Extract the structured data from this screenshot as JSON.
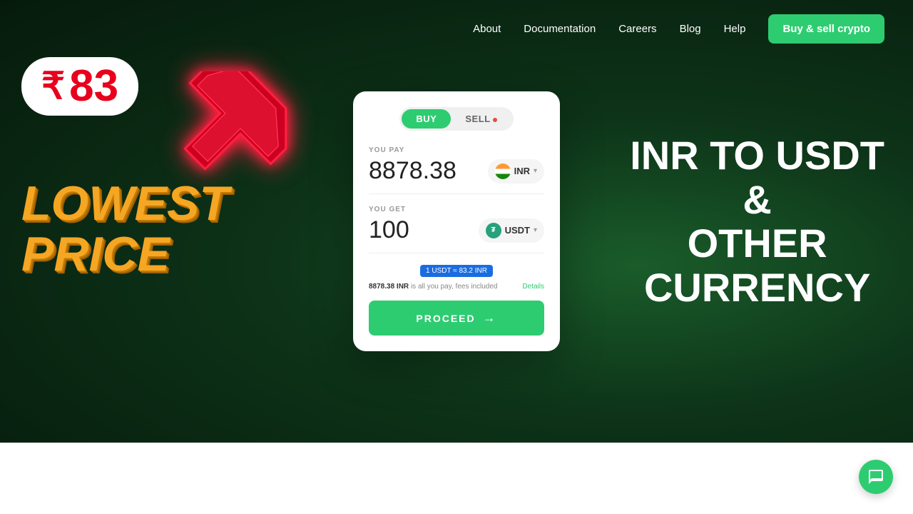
{
  "nav": {
    "links": [
      "About",
      "Documentation",
      "Careers",
      "Blog",
      "Help"
    ],
    "cta_label": "Buy & sell crypto"
  },
  "hero": {
    "price_symbol": "₹",
    "price_value": "83",
    "lowest_line1": "LOWEST",
    "lowest_line2": "PRICE",
    "right_title_line1": "INR TO USDT",
    "right_title_line2": "&",
    "right_title_line3": "OTHER",
    "right_title_line4": "CURRENCY"
  },
  "card": {
    "tab_buy": "BUY",
    "tab_sell": "SELL",
    "you_pay_label": "YOU PAY",
    "you_pay_amount": "8878.38",
    "you_pay_currency": "INR",
    "you_get_label": "YOU GET",
    "you_get_amount": "100",
    "you_get_currency": "USDT",
    "rate_badge": "1 USDT ≈ 83.2 INR",
    "fee_text_prefix": "8878.38 INR",
    "fee_text_suffix": "is all you pay, fees included",
    "details_label": "Details",
    "proceed_label": "PROCEED"
  },
  "chat_button": {
    "aria_label": "Chat support"
  }
}
